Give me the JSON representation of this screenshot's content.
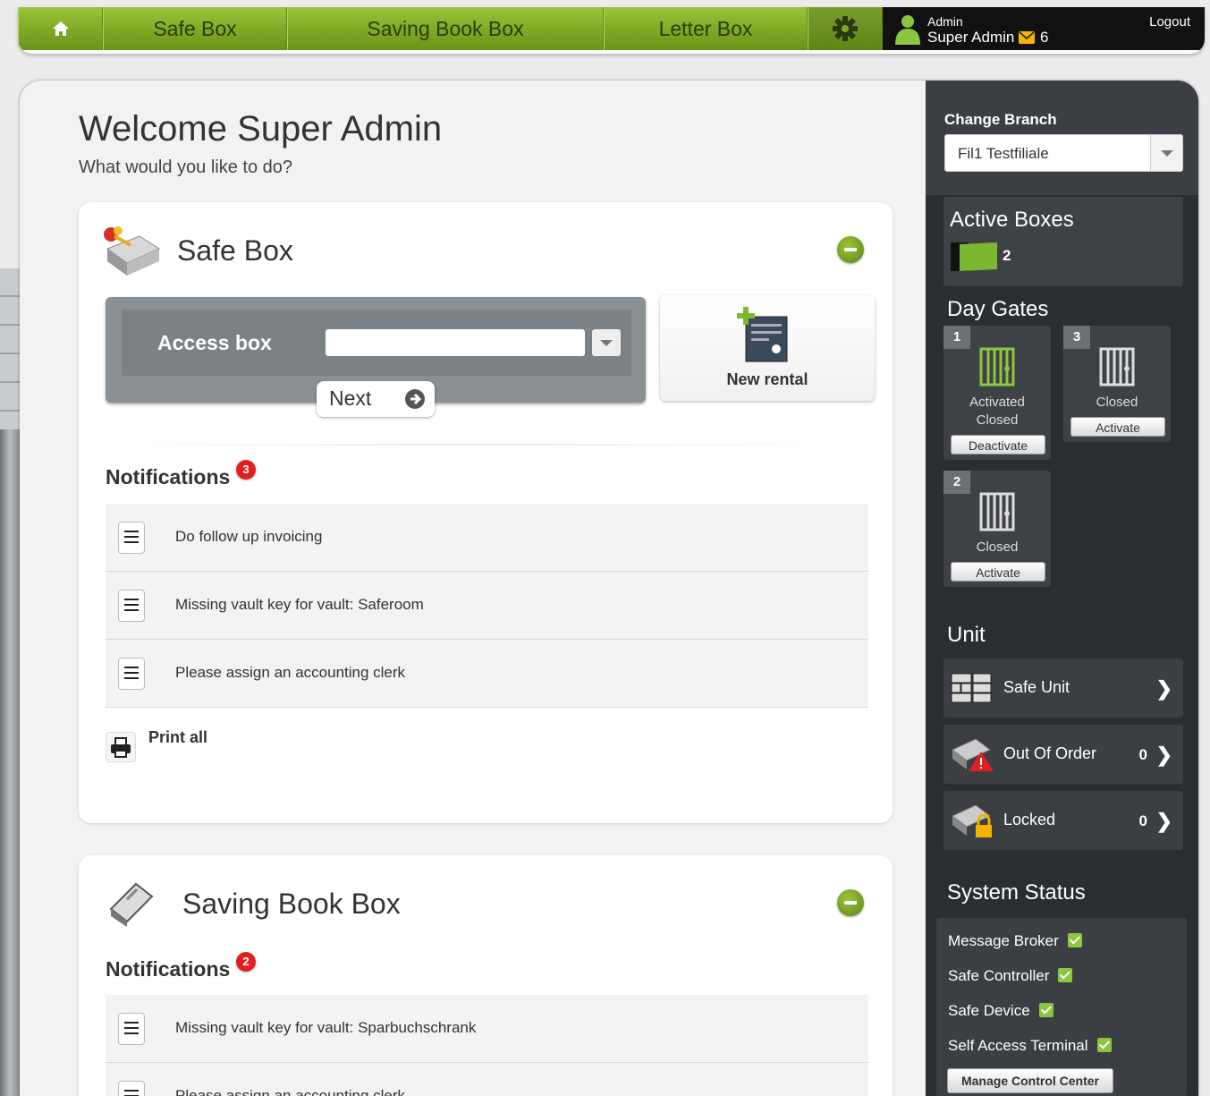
{
  "nav": {
    "items": [
      {
        "label": "Safe Box"
      },
      {
        "label": "Saving Book Box"
      },
      {
        "label": "Letter Box"
      }
    ],
    "user": {
      "role": "Admin",
      "name": "Super Admin",
      "mail_count": "6",
      "logout": "Logout"
    }
  },
  "welcome": {
    "title": "Welcome Super Admin",
    "subtitle": "What would you like to do?"
  },
  "safe_box": {
    "title": "Safe Box",
    "access_label": "Access box",
    "access_value": "",
    "next_label": "Next",
    "new_rental_label": "New rental",
    "notifications_title": "Notifications",
    "notifications_count": "3",
    "notifications": [
      {
        "text": "Do follow up invoicing"
      },
      {
        "text": "Missing vault key for vault: Saferoom"
      },
      {
        "text": "Please assign an accounting clerk"
      }
    ],
    "print_all": "Print all"
  },
  "saving_book_box": {
    "title": "Saving Book Box",
    "notifications_title": "Notifications",
    "notifications_count": "2",
    "notifications": [
      {
        "text": "Missing vault key for vault: Sparbuchschrank"
      },
      {
        "text": "Please assign an accounting clerk"
      }
    ]
  },
  "sidebar": {
    "change_branch_label": "Change Branch",
    "branch_value": "Fil1 Testfiliale",
    "active_boxes_title": "Active Boxes",
    "active_boxes_count": "2",
    "day_gates_title": "Day Gates",
    "gates": [
      {
        "number": "1",
        "status_line1": "Activated",
        "status_line2": "Closed",
        "button": "Deactivate",
        "color": "#8cc63f"
      },
      {
        "number": "3",
        "status_line1": "Closed",
        "status_line2": "",
        "button": "Activate",
        "color": "#dddddd"
      },
      {
        "number": "2",
        "status_line1": "Closed",
        "status_line2": "",
        "button": "Activate",
        "color": "#dddddd"
      }
    ],
    "unit_title": "Unit",
    "units": [
      {
        "label": "Safe Unit",
        "count": "",
        "icon": "safe-unit-icon"
      },
      {
        "label": "Out Of Order",
        "count": "0",
        "icon": "out-of-order-icon"
      },
      {
        "label": "Locked",
        "count": "0",
        "icon": "locked-icon"
      }
    ],
    "system_status_title": "System Status",
    "system_status": [
      {
        "label": "Message Broker",
        "ok": true
      },
      {
        "label": "Safe Controller",
        "ok": true
      },
      {
        "label": "Safe Device",
        "ok": true
      },
      {
        "label": "Self Access Terminal",
        "ok": true
      }
    ],
    "manage_button": "Manage Control Center"
  },
  "colors": {
    "accent_green": "#8cc63f",
    "nav_green": "#7ea824",
    "sidebar_dark": "#2b2e31",
    "badge_red": "#e02020"
  }
}
